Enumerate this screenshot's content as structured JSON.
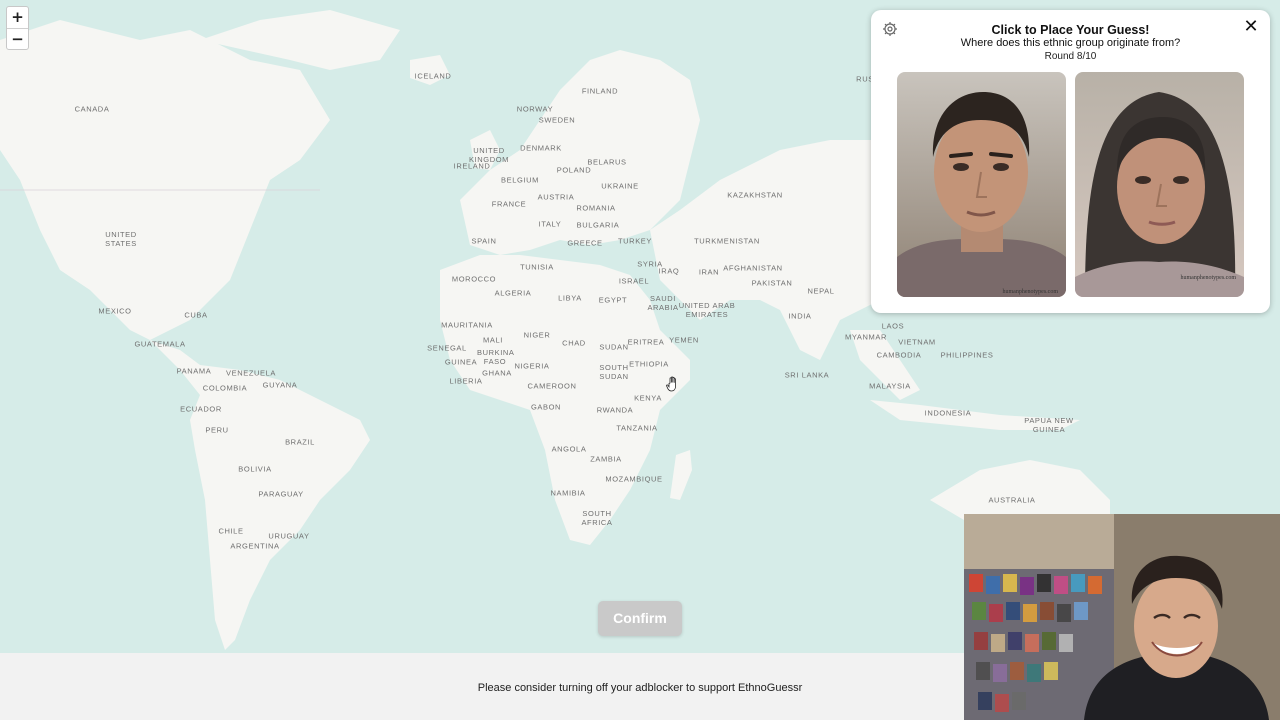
{
  "map": {
    "labels": [
      {
        "text": "CANADA"
      },
      {
        "text": "UNITED STATES"
      },
      {
        "text": "MEXICO"
      },
      {
        "text": "CUBA"
      },
      {
        "text": "GUATEMALA"
      },
      {
        "text": "PANAMA"
      },
      {
        "text": "VENEZUELA"
      },
      {
        "text": "GUYANA"
      },
      {
        "text": "COLOMBIA"
      },
      {
        "text": "ECUADOR"
      },
      {
        "text": "PERU"
      },
      {
        "text": "BRAZIL"
      },
      {
        "text": "BOLIVIA"
      },
      {
        "text": "PARAGUAY"
      },
      {
        "text": "CHILE"
      },
      {
        "text": "URUGUAY"
      },
      {
        "text": "ARGENTINA"
      },
      {
        "text": "ICELAND"
      },
      {
        "text": "FINLAND"
      },
      {
        "text": "NORWAY"
      },
      {
        "text": "SWEDEN"
      },
      {
        "text": "UNITED KINGDOM"
      },
      {
        "text": "IRELAND"
      },
      {
        "text": "DENMARK"
      },
      {
        "text": "BELARUS"
      },
      {
        "text": "POLAND"
      },
      {
        "text": "BELGIUM"
      },
      {
        "text": "UKRAINE"
      },
      {
        "text": "FRANCE"
      },
      {
        "text": "AUSTRIA"
      },
      {
        "text": "ROMANIA"
      },
      {
        "text": "ITALY"
      },
      {
        "text": "BULGARIA"
      },
      {
        "text": "SPAIN"
      },
      {
        "text": "GREECE"
      },
      {
        "text": "TURKEY"
      },
      {
        "text": "KAZAKHSTAN"
      },
      {
        "text": "TURKMENISTAN"
      },
      {
        "text": "MOROCCO"
      },
      {
        "text": "TUNISIA"
      },
      {
        "text": "SYRIA"
      },
      {
        "text": "IRAQ"
      },
      {
        "text": "IRAN"
      },
      {
        "text": "AFGHANISTAN"
      },
      {
        "text": "ISRAEL"
      },
      {
        "text": "ALGERIA"
      },
      {
        "text": "LIBYA"
      },
      {
        "text": "EGYPT"
      },
      {
        "text": "SAUDI ARABIA"
      },
      {
        "text": "UNITED ARAB EMIRATES"
      },
      {
        "text": "PAKISTAN"
      },
      {
        "text": "NEPAL"
      },
      {
        "text": "INDIA"
      },
      {
        "text": "MAURITANIA"
      },
      {
        "text": "MALI"
      },
      {
        "text": "NIGER"
      },
      {
        "text": "CHAD"
      },
      {
        "text": "SUDAN"
      },
      {
        "text": "ERITREA"
      },
      {
        "text": "YEMEN"
      },
      {
        "text": "SENEGAL"
      },
      {
        "text": "GUINEA"
      },
      {
        "text": "BURKINA FASO"
      },
      {
        "text": "NIGERIA"
      },
      {
        "text": "GHANA"
      },
      {
        "text": "ETHIOPIA"
      },
      {
        "text": "SOUTH SUDAN"
      },
      {
        "text": "LIBERIA"
      },
      {
        "text": "CAMEROON"
      },
      {
        "text": "KENYA"
      },
      {
        "text": "GABON"
      },
      {
        "text": "RWANDA"
      },
      {
        "text": "TANZANIA"
      },
      {
        "text": "ANGOLA"
      },
      {
        "text": "ZAMBIA"
      },
      {
        "text": "MOZAMBIQUE"
      },
      {
        "text": "NAMIBIA"
      },
      {
        "text": "SOUTH AFRICA"
      },
      {
        "text": "MYANMAR"
      },
      {
        "text": "LAOS"
      },
      {
        "text": "VIETNAM"
      },
      {
        "text": "CAMBODIA"
      },
      {
        "text": "PHILIPPINES"
      },
      {
        "text": "SRI LANKA"
      },
      {
        "text": "MALAYSIA"
      },
      {
        "text": "INDONESIA"
      },
      {
        "text": "PAPUA NEW GUINEA"
      },
      {
        "text": "AUSTRALIA"
      },
      {
        "text": "RUS"
      }
    ]
  },
  "zoom": {
    "in_label": "+",
    "out_label": "−"
  },
  "panel": {
    "title": "Click to Place Your Guess!",
    "subtitle": "Where does this ethnic group originate from?",
    "round": "Round 8/10",
    "close_label": "✕",
    "settings_icon": "settings-icon",
    "images": [
      {
        "alt": "male face",
        "credit": "humanphenotypes.com"
      },
      {
        "alt": "female face",
        "credit": "humanphenotypes.com"
      }
    ]
  },
  "confirm_label": "Confirm",
  "footer": {
    "text": "Please consider turning off your adblocker to support EthnoGuessr"
  },
  "colors": {
    "water": "#aad3df",
    "land": "#f7f7f4",
    "confirm": "#c9c9c9"
  }
}
